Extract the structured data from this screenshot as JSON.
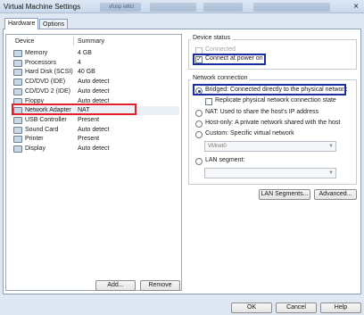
{
  "window": {
    "title": "Virtual Machine Settings",
    "blur_tab_label": "vfusp ietlcl",
    "close_glyph": "×"
  },
  "tabs": [
    {
      "label": "Hardware"
    },
    {
      "label": "Options"
    }
  ],
  "device_list": {
    "col_device": "Device",
    "col_summary": "Summary",
    "rows": [
      {
        "name": "Memory",
        "summary": "4 GB",
        "icon": "memory-icon"
      },
      {
        "name": "Processors",
        "summary": "4",
        "icon": "processor-icon"
      },
      {
        "name": "Hard Disk (SCSI)",
        "summary": "40 GB",
        "icon": "hard-disk-icon"
      },
      {
        "name": "CD/DVD (IDE)",
        "summary": "Auto detect",
        "icon": "cd-dvd-icon"
      },
      {
        "name": "CD/DVD 2 (IDE)",
        "summary": "Auto detect",
        "icon": "cd-dvd-icon"
      },
      {
        "name": "Floppy",
        "summary": "Auto detect",
        "icon": "floppy-icon"
      },
      {
        "name": "Network Adapter",
        "summary": "NAT",
        "icon": "network-adapter-icon"
      },
      {
        "name": "USB Controller",
        "summary": "Present",
        "icon": "usb-icon"
      },
      {
        "name": "Sound Card",
        "summary": "Auto detect",
        "icon": "sound-card-icon"
      },
      {
        "name": "Printer",
        "summary": "Present",
        "icon": "printer-icon"
      },
      {
        "name": "Display",
        "summary": "Auto detect",
        "icon": "display-icon"
      }
    ],
    "selected_index": 6
  },
  "list_buttons": {
    "add": "Add...",
    "remove": "Remove"
  },
  "device_status": {
    "title": "Device status",
    "connected": "Connected",
    "connected_checked": false,
    "connect_at_power_on": "Connect at power on",
    "connect_at_power_on_checked": true
  },
  "network_connection": {
    "title": "Network connection",
    "bridged": "Bridged: Connected directly to the physical network",
    "replicate": "Replicate physical network connection state",
    "nat": "NAT: Used to share the host's IP address",
    "host_only": "Host-only: A private network shared with the host",
    "custom": "Custom: Specific virtual network",
    "custom_value": "VMnet0",
    "lan_segment": "LAN segment:",
    "lan_segment_value": "",
    "selected": "bridged"
  },
  "net_buttons": {
    "lan_segments": "LAN Segments...",
    "advanced": "Advanced..."
  },
  "footer": {
    "ok": "OK",
    "cancel": "Cancel",
    "help": "Help"
  },
  "colors": {
    "highlight_red": "#e0202a",
    "highlight_blue": "#1a2ea0",
    "window_bg": "#dfe8f2"
  }
}
